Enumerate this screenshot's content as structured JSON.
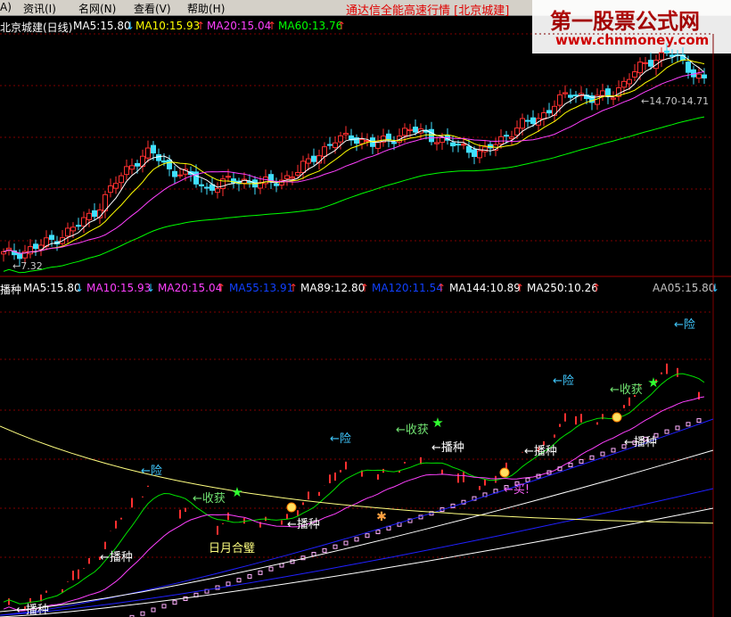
{
  "menubar": {
    "items": [
      "A)",
      "资讯(I)",
      "名网(N)",
      "查看(V)",
      "帮助(H)"
    ],
    "title": "通达信全能高速行情 [北京城建]"
  },
  "watermark": {
    "title": "第一股票公式网",
    "url": "www.chnmoney.com"
  },
  "top_legend": {
    "stock": "北京城建(日线)",
    "ma5": "MA5:15.80",
    "ma10": "MA10:15.93",
    "ma20": "MA20:15.04",
    "ma60": "MA60:13.76",
    "colors": {
      "ma5": "#ffffff",
      "ma10": "#ffff00",
      "ma20": "#ff40ff",
      "ma60": "#00ff00"
    }
  },
  "bottom_legend": {
    "indicator": "播种",
    "ma5": "MA5:15.80",
    "ma10": "MA10:15.93",
    "ma20": "MA20:15.04",
    "ma55": "MA55:13.91",
    "ma89": "MA89:12.80",
    "ma120": "MA120:11.54",
    "ma144": "MA144:10.89",
    "ma250": "MA250:10.26",
    "aa05": "AA05:15.80",
    "colors": {
      "ma5": "#ffffff",
      "ma10": "#ff40ff",
      "ma20": "#ff40ff",
      "ma55": "#0040ff",
      "ma89": "#ffffff",
      "ma120": "#0040ff",
      "ma144": "#ffffff",
      "ma250": "#ff3030",
      "aa05": "#c0c0c0"
    }
  },
  "annotations": {
    "low_price": "7.32",
    "high_range": "14.70-14.71",
    "danger": "险",
    "harvest": "收获",
    "sow": "播种",
    "buy": "买",
    "sun_moon": "日月合璧"
  },
  "chart_data": {
    "type": "line",
    "title": "",
    "price_range": [
      7.32,
      17.0
    ],
    "series": [
      {
        "name": "MA5",
        "values": [
          15.8
        ]
      },
      {
        "name": "MA10",
        "values": [
          15.93
        ]
      },
      {
        "name": "MA20",
        "values": [
          15.04
        ]
      },
      {
        "name": "MA60",
        "values": [
          13.76
        ]
      }
    ],
    "close_path": [
      7.6,
      7.7,
      8.0,
      8.4,
      8.9,
      9.6,
      10.8,
      11.8,
      12.3,
      11.5,
      11.2,
      10.6,
      10.9,
      11.0,
      10.8,
      11.0,
      11.4,
      12.2,
      12.8,
      13.0,
      12.6,
      12.9,
      13.3,
      13.1,
      12.7,
      12.5,
      12.2,
      12.9,
      13.5,
      13.8,
      14.6,
      15.0,
      14.7,
      14.9,
      15.8,
      16.4,
      16.9,
      16.2,
      15.6
    ]
  }
}
